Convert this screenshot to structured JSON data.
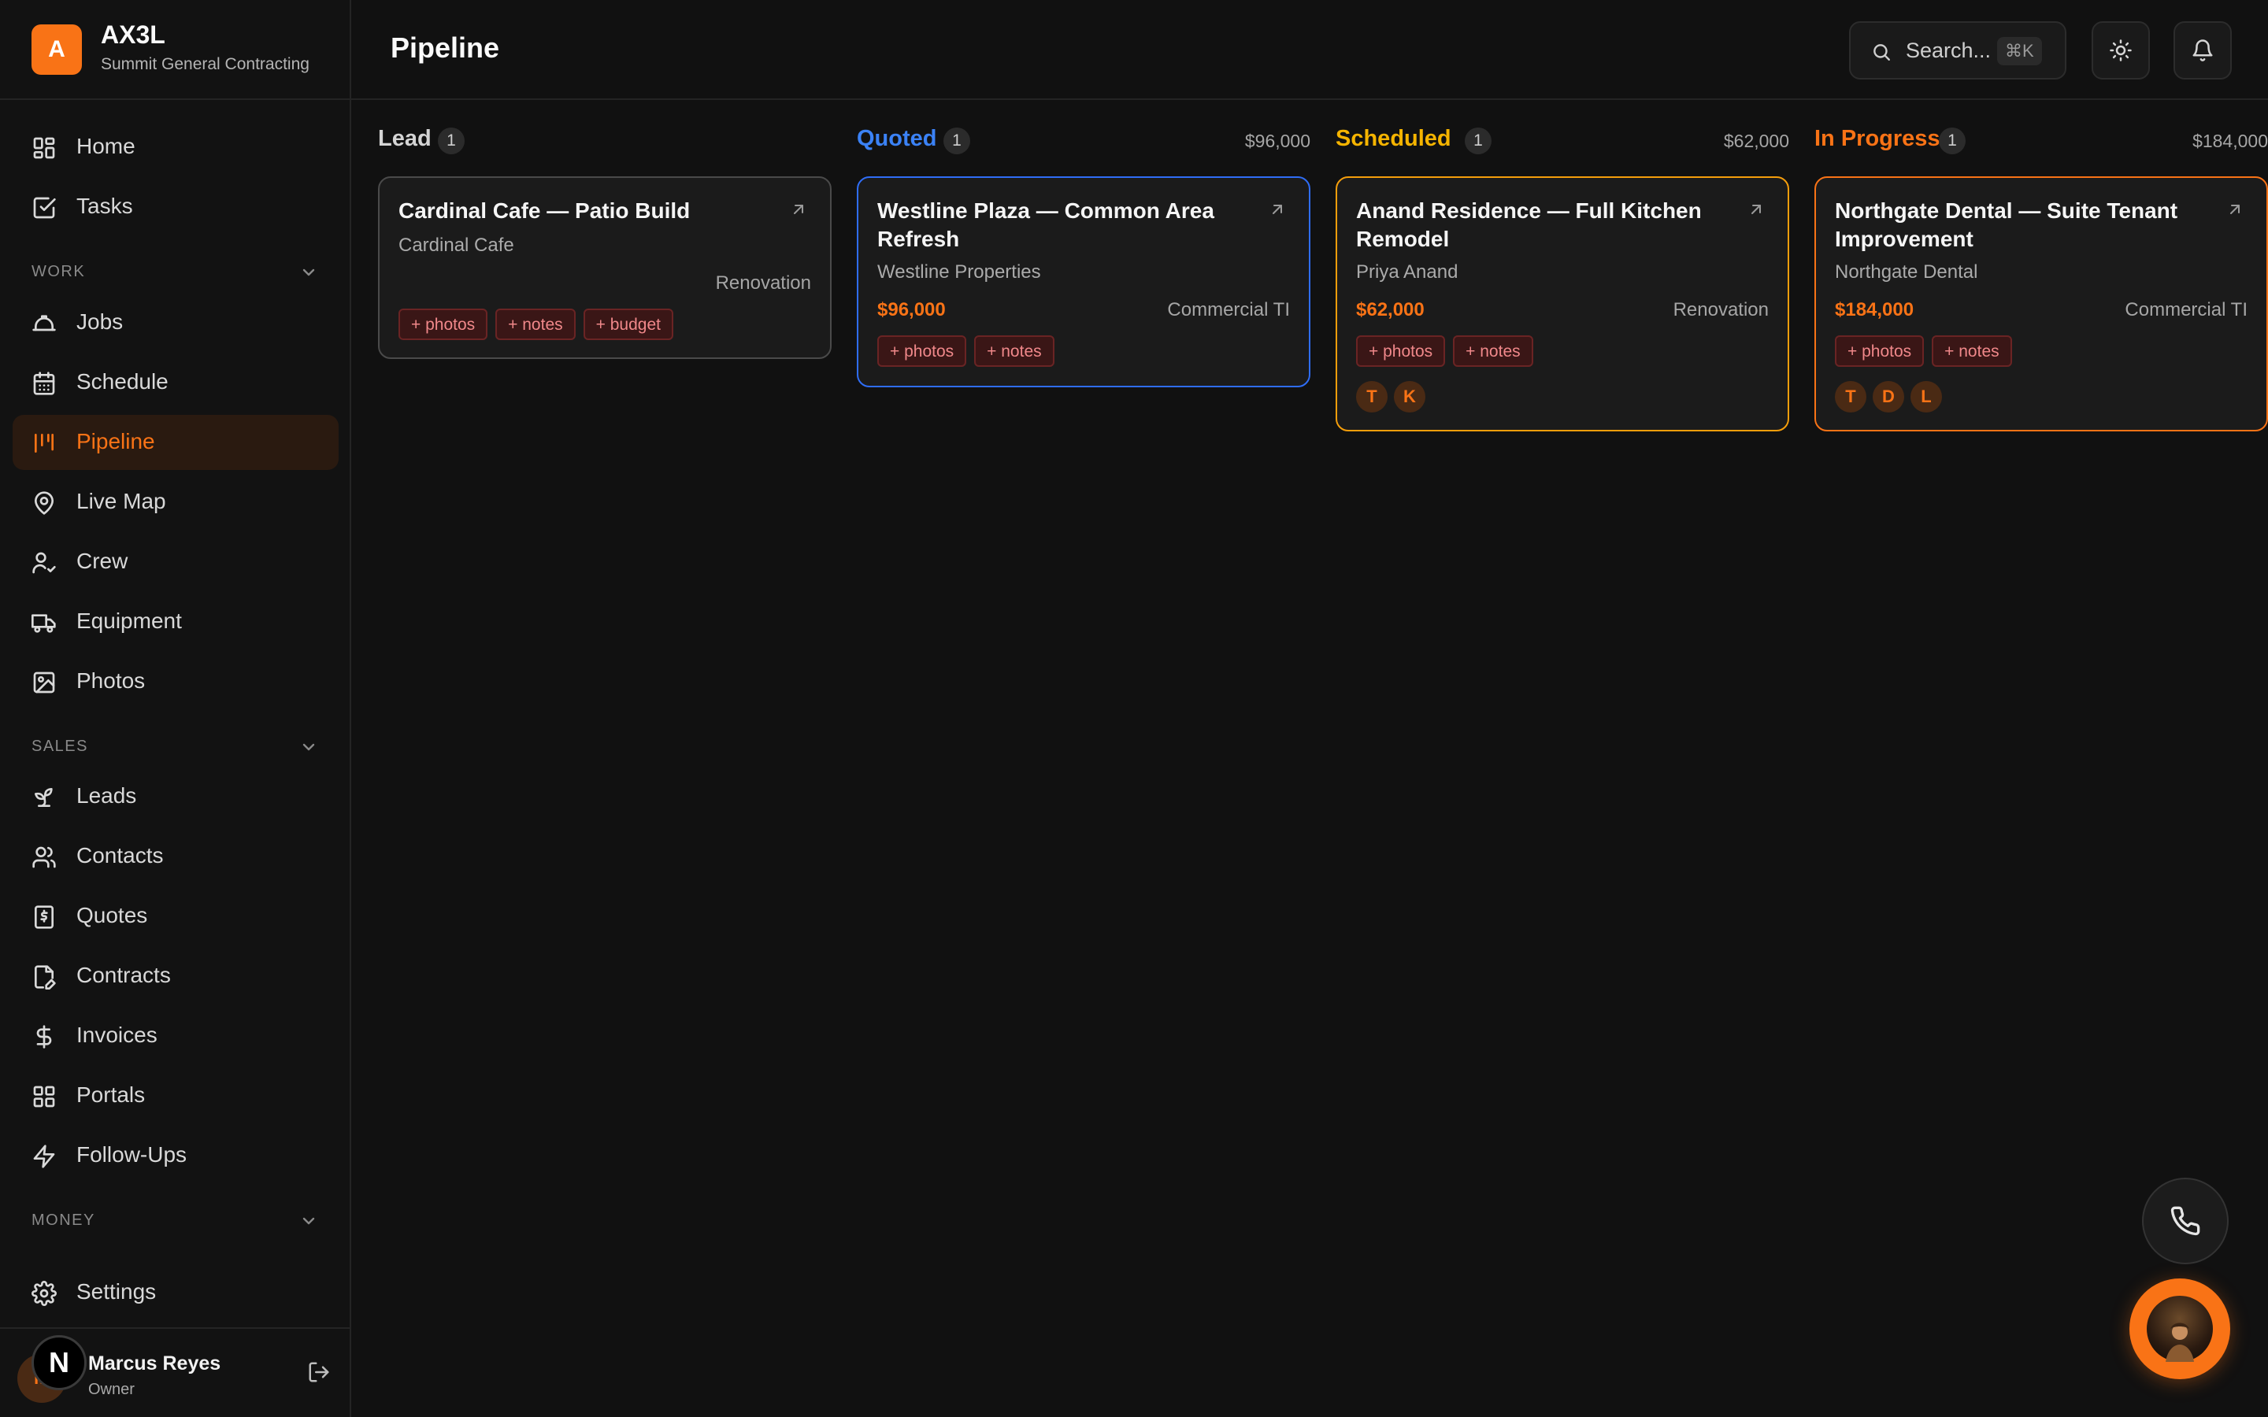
{
  "brand": {
    "logo_letter": "A",
    "name": "AX3L",
    "subtitle": "Summit General Contracting",
    "accent_color": "#f97316"
  },
  "sidebar": {
    "top_items": [
      {
        "label": "Home",
        "icon": "grid-icon"
      },
      {
        "label": "Tasks",
        "icon": "checkbox-icon"
      }
    ],
    "sections": [
      {
        "label": "WORK",
        "items": [
          {
            "label": "Jobs",
            "icon": "hardhat-icon"
          },
          {
            "label": "Schedule",
            "icon": "calendar-icon"
          },
          {
            "label": "Pipeline",
            "icon": "pipeline-icon",
            "active": true
          },
          {
            "label": "Live Map",
            "icon": "map-pin-icon"
          },
          {
            "label": "Crew",
            "icon": "user-check-icon"
          },
          {
            "label": "Equipment",
            "icon": "truck-icon"
          },
          {
            "label": "Photos",
            "icon": "image-icon"
          }
        ]
      },
      {
        "label": "SALES",
        "items": [
          {
            "label": "Leads",
            "icon": "sprout-icon"
          },
          {
            "label": "Contacts",
            "icon": "users-icon"
          },
          {
            "label": "Quotes",
            "icon": "receipt-icon"
          },
          {
            "label": "Contracts",
            "icon": "file-signature-icon"
          },
          {
            "label": "Invoices",
            "icon": "dollar-icon"
          },
          {
            "label": "Portals",
            "icon": "grid-icon"
          },
          {
            "label": "Follow-Ups",
            "icon": "zap-icon"
          }
        ]
      },
      {
        "label": "MONEY",
        "items": []
      }
    ],
    "settings_label": "Settings",
    "user": {
      "initial": "M",
      "name": "Marcus Reyes",
      "role": "Owner",
      "overlay_badge": "N"
    }
  },
  "header": {
    "title": "Pipeline",
    "search_placeholder": "Search...",
    "search_shortcut": "⌘K"
  },
  "columns": [
    {
      "title": "Lead",
      "color": "#d4d4d4",
      "count": "1",
      "total": "",
      "cards": [
        {
          "title": "Cardinal Cafe — Patio Build",
          "client": "Cardinal Cafe",
          "amount": "",
          "type": "Renovation",
          "tags": [
            "+ photos",
            "+ notes",
            "+ budget"
          ],
          "crew": []
        }
      ]
    },
    {
      "title": "Quoted",
      "color": "#3b82f6",
      "count": "1",
      "total": "$96,000",
      "cards": [
        {
          "title": "Westline Plaza — Common Area Refresh",
          "client": "Westline Properties",
          "amount": "$96,000",
          "type": "Commercial TI",
          "tags": [
            "+ photos",
            "+ notes"
          ],
          "crew": []
        }
      ]
    },
    {
      "title": "Scheduled",
      "color": "#f5b400",
      "count": "1",
      "total": "$62,000",
      "cards": [
        {
          "title": "Anand Residence — Full Kitchen Remodel",
          "client": "Priya Anand",
          "amount": "$62,000",
          "type": "Renovation",
          "tags": [
            "+ photos",
            "+ notes"
          ],
          "crew": [
            "T",
            "K"
          ]
        }
      ]
    },
    {
      "title": "In Progress",
      "color": "#f97316",
      "count": "1",
      "total": "$184,000",
      "cards": [
        {
          "title": "Northgate Dental — Suite Tenant Improvement",
          "client": "Northgate Dental",
          "amount": "$184,000",
          "type": "Commercial TI",
          "tags": [
            "+ photos",
            "+ notes"
          ],
          "crew": [
            "T",
            "D",
            "L"
          ]
        }
      ]
    }
  ]
}
